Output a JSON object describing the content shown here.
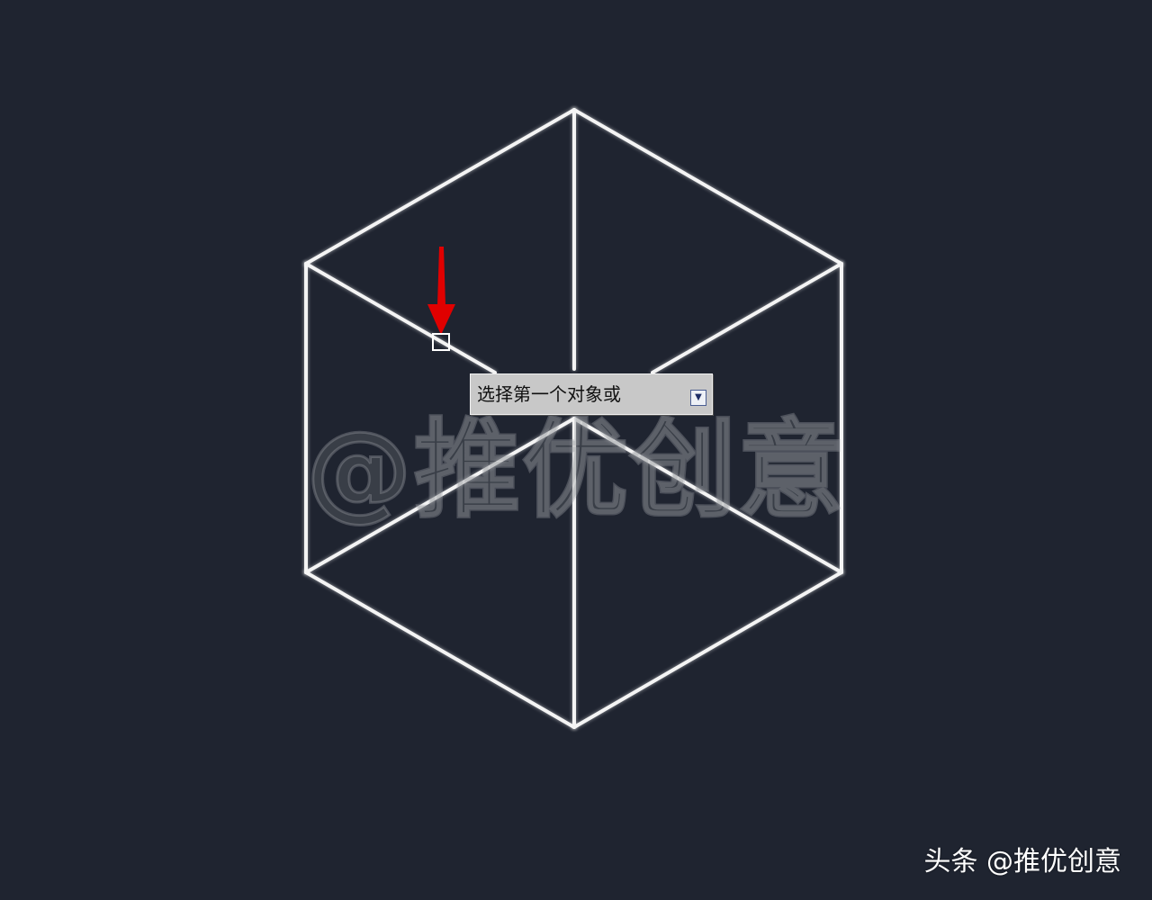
{
  "tooltip": {
    "prompt": "选择第一个对象或",
    "dropdown_icon": "arrow-down-icon"
  },
  "watermark": {
    "center_text": "@推优创意",
    "footer_text": "头条 @推优创意"
  },
  "colors": {
    "background": "#1f2430",
    "lines": "#f4f4f4",
    "arrow": "#e00000",
    "tooltip_bg": "#c8c8c8"
  }
}
